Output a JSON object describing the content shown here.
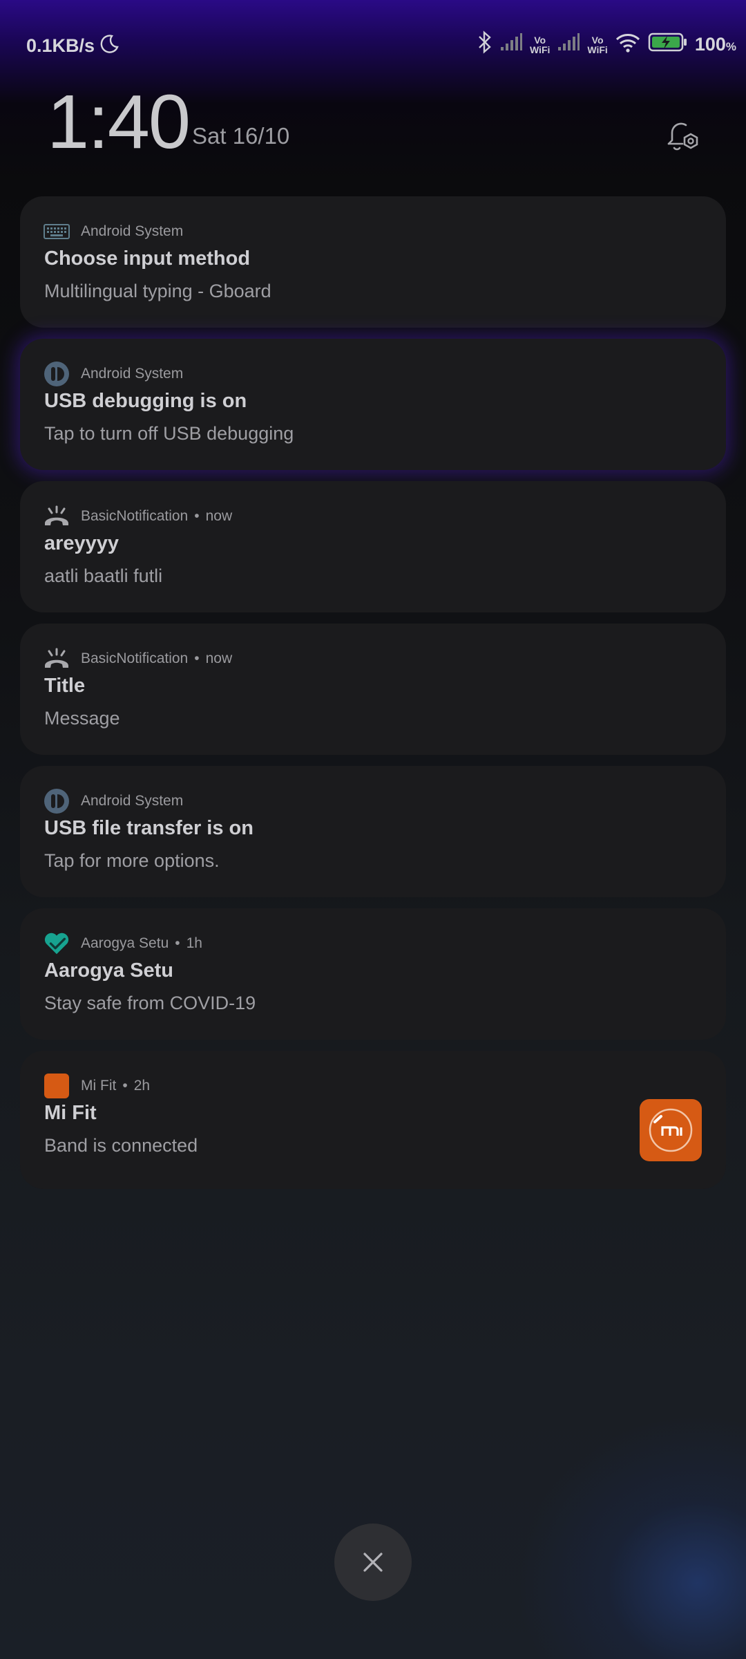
{
  "status_bar": {
    "network_speed": "0.1KB/s",
    "dnd_icon": "moon-icon",
    "vo_label": "Vo",
    "wifi_label": "WiFi",
    "battery_percent": "100",
    "battery_unit": "%"
  },
  "header": {
    "time": "1:40",
    "date": "Sat 16/10",
    "settings_icon": "notification-settings-icon"
  },
  "notifications": [
    {
      "app": "Android System",
      "time": "",
      "title": "Choose input method",
      "text": "Multilingual typing - Gboard",
      "icon": "keyboard-icon"
    },
    {
      "app": "Android System",
      "time": "",
      "title": "USB debugging is on",
      "text": "Tap to turn off USB debugging",
      "icon": "android-system-icon"
    },
    {
      "app": "BasicNotification",
      "time": "now",
      "title": "areyyyy",
      "text": "aatli baatli futli",
      "icon": "phone-ringing-icon"
    },
    {
      "app": "BasicNotification",
      "time": "now",
      "title": "Title",
      "text": "Message",
      "icon": "phone-ringing-icon"
    },
    {
      "app": "Android System",
      "time": "",
      "title": "USB file transfer is on",
      "text": "Tap for more options.",
      "icon": "android-system-icon"
    },
    {
      "app": "Aarogya Setu",
      "time": "1h",
      "title": "Aarogya Setu",
      "text": "Stay safe from COVID-19",
      "icon": "heart-check-icon"
    },
    {
      "app": "Mi Fit",
      "time": "2h",
      "title": "Mi Fit",
      "text": "Band is connected",
      "icon": "mi-fit-icon"
    }
  ],
  "colors": {
    "card_bg": "#1b1b1d",
    "mi_fit_orange": "#d65a14",
    "aarogya_teal": "#1aa38f",
    "android_icon_blue": "#5b6f86"
  },
  "close_icon": "close-icon"
}
